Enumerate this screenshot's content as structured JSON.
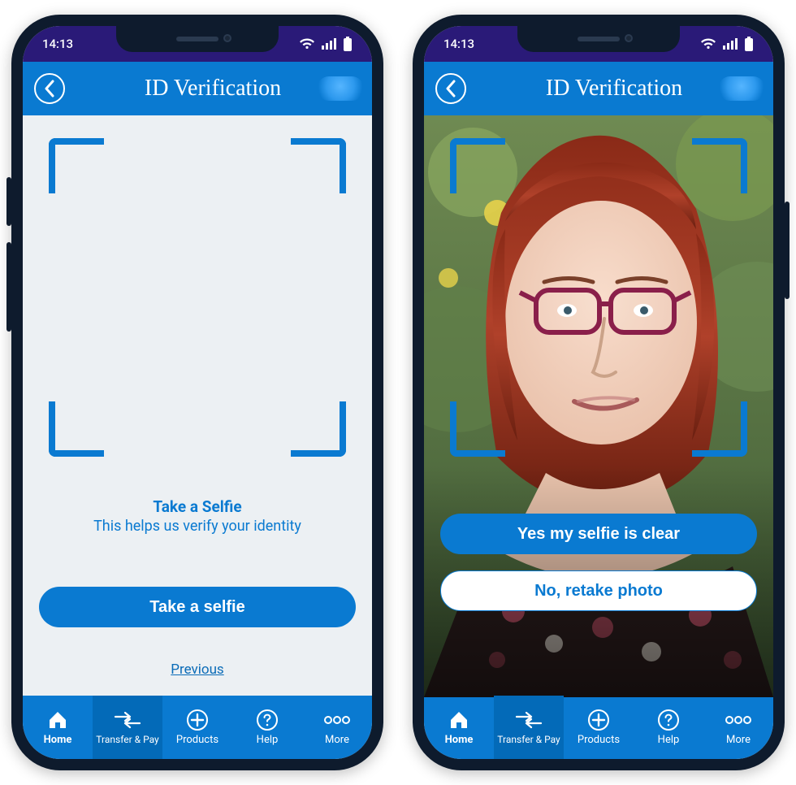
{
  "status": {
    "time": "14:13"
  },
  "header": {
    "title": "ID Verification"
  },
  "left": {
    "heading": "Take a Selfie",
    "sub": "This helps us verify your identity",
    "cta": "Take a selfie",
    "prev": "Previous"
  },
  "right": {
    "yes": "Yes my selfie is clear",
    "no": "No, retake photo"
  },
  "tabs": {
    "home": "Home",
    "transfer": "Transfer & Pay",
    "products": "Products",
    "help": "Help",
    "more": "More"
  },
  "colors": {
    "brand": "#0a7ad1",
    "statusbar": "#2a1a78"
  }
}
